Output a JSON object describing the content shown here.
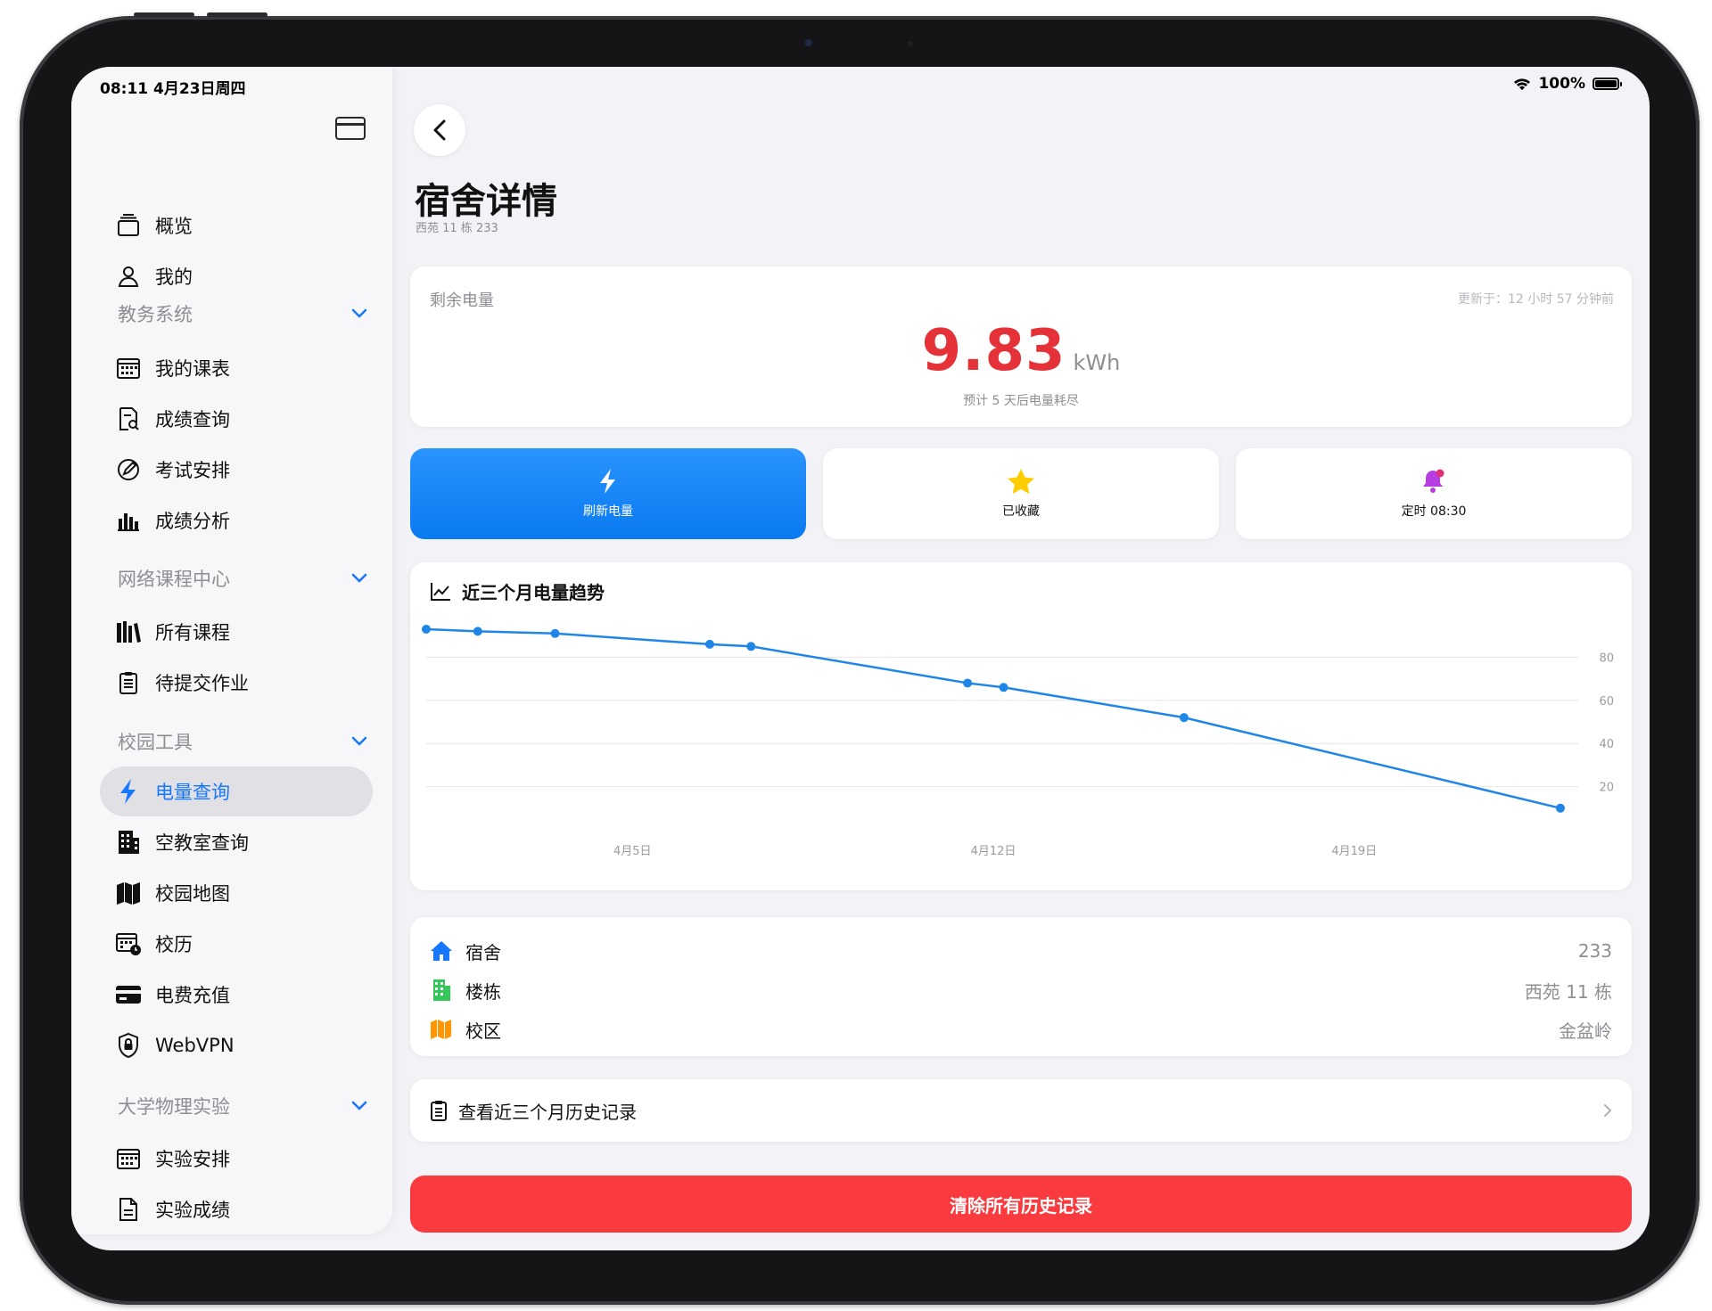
{
  "status": {
    "time": "08:11  4月23日周四",
    "battery": "100%"
  },
  "sidebar": {
    "top_items": [
      {
        "label": "概览",
        "icon": "stack-icon"
      },
      {
        "label": "我的",
        "icon": "person-icon"
      }
    ],
    "sections": [
      {
        "title": "教务系统",
        "items": [
          {
            "label": "我的课表",
            "icon": "calendar-icon"
          },
          {
            "label": "成绩查询",
            "icon": "doc-search-icon"
          },
          {
            "label": "考试安排",
            "icon": "pencil-circle-icon"
          },
          {
            "label": "成绩分析",
            "icon": "bar-chart-icon"
          }
        ]
      },
      {
        "title": "网络课程中心",
        "items": [
          {
            "label": "所有课程",
            "icon": "books-icon"
          },
          {
            "label": "待提交作业",
            "icon": "clipboard-icon"
          }
        ]
      },
      {
        "title": "校园工具",
        "items": [
          {
            "label": "电量查询",
            "icon": "bolt-icon",
            "active": true
          },
          {
            "label": "空教室查询",
            "icon": "building-icon"
          },
          {
            "label": "校园地图",
            "icon": "map-icon"
          },
          {
            "label": "校历",
            "icon": "calendar-clock-icon"
          },
          {
            "label": "电费充值",
            "icon": "credit-card-icon"
          },
          {
            "label": "WebVPN",
            "icon": "lock-shield-icon"
          }
        ]
      },
      {
        "title": "大学物理实验",
        "items": [
          {
            "label": "实验安排",
            "icon": "calendar-icon"
          },
          {
            "label": "实验成绩",
            "icon": "document-icon"
          }
        ]
      }
    ]
  },
  "main": {
    "title": "宿舍详情",
    "subtitle": "西苑 11 栋 233",
    "energy": {
      "label": "剩余电量",
      "updated": "更新于：12 小时 57 分钟前",
      "value": "9.83",
      "unit": "kWh",
      "hint": "预计 5 天后电量耗尽"
    },
    "actions": {
      "refresh": "刷新电量",
      "favorite": "已收藏",
      "schedule": "定时 08:30"
    },
    "chart_title": "近三个月电量趋势",
    "info": [
      {
        "label": "宿舍",
        "value": "233",
        "icon": "house-icon",
        "color": "#1677ff"
      },
      {
        "label": "楼栋",
        "value": "西苑 11 栋",
        "icon": "building-icon",
        "color": "#34c759"
      },
      {
        "label": "校区",
        "value": "金盆岭",
        "icon": "map-icon",
        "color": "#ff9500"
      }
    ],
    "history": "查看近三个月历史记录",
    "clear": "清除所有历史记录"
  },
  "chart_data": {
    "type": "line",
    "x": [
      "4月1日",
      "4月2日",
      "4月3日",
      "4月6日",
      "4月7日",
      "4月12日",
      "4月13日",
      "4月16日",
      "4月23日"
    ],
    "x_day": [
      1,
      2,
      3.5,
      6.5,
      7.3,
      11.5,
      12.2,
      15.7,
      23
    ],
    "series": [
      {
        "values": [
          93,
          92,
          91,
          86,
          85,
          68,
          66,
          52,
          10
        ]
      }
    ],
    "xticks": [
      {
        "day": 5,
        "label": "4月5日"
      },
      {
        "day": 12,
        "label": "4月12日"
      },
      {
        "day": 19,
        "label": "4月19日"
      }
    ],
    "yticks": [
      20,
      40,
      60,
      80
    ],
    "ylim": [
      0,
      100
    ],
    "color": "#1f86e8",
    "grid": true
  }
}
